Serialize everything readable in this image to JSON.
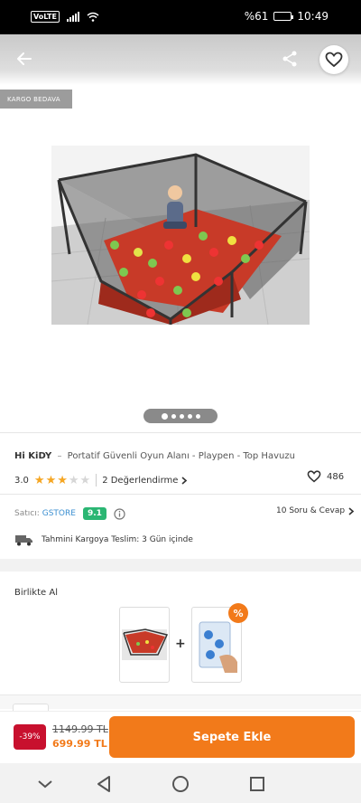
{
  "status_bar": {
    "network": "VoLTE",
    "battery_percent": "%61",
    "time": "10:49",
    "battery_level": 0.61
  },
  "hero": {
    "cargo_badge": "KARGO BEDAVA",
    "image_count": 5,
    "active_image": 1
  },
  "product": {
    "brand": "Hi KiDY",
    "separator": "–",
    "name": "Portatif Güvenli Oyun Alanı - Playpen - Top Havuzu",
    "rating_value": "3.0",
    "rating_stars": 3,
    "rating_max": 5,
    "reviews_label": "2 Değerlendirme",
    "favorite_count": "486"
  },
  "seller": {
    "label": "Satıcı:",
    "name": "GSTORE",
    "score": "9.1",
    "qa_label": "10 Soru & Cevap"
  },
  "delivery": {
    "text": "Tahmini Kargoya Teslim: 3 Gün içinde"
  },
  "bundle": {
    "title": "Birlikte Al",
    "plus": "+",
    "badge": "%"
  },
  "cart": {
    "discount": "-39%",
    "old_price": "1149.99 TL",
    "new_price": "699.99 TL",
    "button": "Sepete Ekle"
  },
  "colors": {
    "accent": "#f27a1a",
    "discount": "#c8102e",
    "score": "#2bb673",
    "seller_link": "#3b8fd1"
  },
  "icons": {
    "back": "arrow-left-icon",
    "share": "share-icon",
    "favorite": "heart-icon",
    "chevron": "chevron-right-icon",
    "info": "info-icon",
    "truck": "truck-icon",
    "nav_back": "triangle-back-icon",
    "nav_home": "circle-home-icon",
    "nav_recent": "square-recent-icon",
    "nav_down": "chevron-down-icon"
  }
}
